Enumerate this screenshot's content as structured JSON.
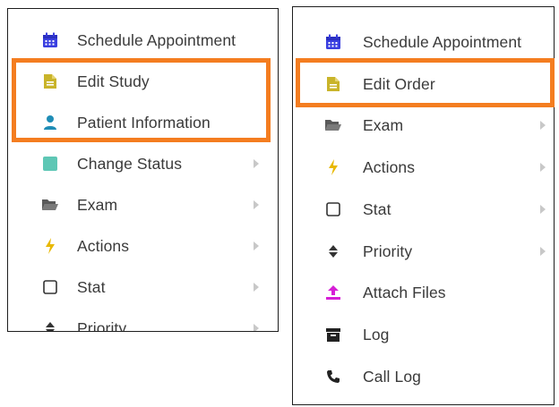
{
  "left_menu": {
    "items": [
      {
        "label": "Schedule Appointment",
        "icon": "calendar-icon",
        "color": "#3a3fe0",
        "submenu": false
      },
      {
        "label": "Edit Study",
        "icon": "document-icon",
        "color": "#c9b42a",
        "submenu": false
      },
      {
        "label": "Patient Information",
        "icon": "person-icon",
        "color": "#1f8db6",
        "submenu": false
      },
      {
        "label": "Change Status",
        "icon": "square-filled-icon",
        "color": "#5ec7b5",
        "submenu": true
      },
      {
        "label": "Exam",
        "icon": "folder-open-icon",
        "color": "#5a5a5a",
        "submenu": true
      },
      {
        "label": "Actions",
        "icon": "bolt-icon",
        "color": "#e8b800",
        "submenu": true
      },
      {
        "label": "Stat",
        "icon": "square-outline-icon",
        "color": "#333333",
        "submenu": true
      },
      {
        "label": "Priority",
        "icon": "sort-icon",
        "color": "#333333",
        "submenu": true
      }
    ]
  },
  "right_menu": {
    "items": [
      {
        "label": "Schedule Appointment",
        "icon": "calendar-icon",
        "color": "#3a3fe0",
        "submenu": false
      },
      {
        "label": "Edit Order",
        "icon": "document-icon",
        "color": "#c9b42a",
        "submenu": false
      },
      {
        "label": "Exam",
        "icon": "folder-open-icon",
        "color": "#5a5a5a",
        "submenu": true
      },
      {
        "label": "Actions",
        "icon": "bolt-icon",
        "color": "#e8b800",
        "submenu": true
      },
      {
        "label": "Stat",
        "icon": "square-outline-icon",
        "color": "#333333",
        "submenu": true
      },
      {
        "label": "Priority",
        "icon": "sort-icon",
        "color": "#333333",
        "submenu": true
      },
      {
        "label": "Attach Files",
        "icon": "upload-icon",
        "color": "#d61fd6",
        "submenu": false
      },
      {
        "label": "Log",
        "icon": "archive-icon",
        "color": "#222222",
        "submenu": false
      },
      {
        "label": "Call Log",
        "icon": "phone-icon",
        "color": "#222222",
        "submenu": false
      }
    ]
  },
  "highlight_color": "#f47d20"
}
